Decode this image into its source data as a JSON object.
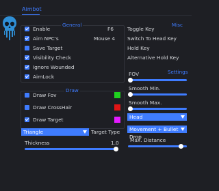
{
  "tabs": {
    "active": "Aimbot"
  },
  "general": {
    "title": "General",
    "items": [
      {
        "label": "Enable",
        "checked": true,
        "key": "F6"
      },
      {
        "label": "Aim NPC's",
        "checked": true,
        "key": "Mouse 4"
      },
      {
        "label": "Save Target",
        "checked": false
      },
      {
        "label": "Visibility Check",
        "checked": true
      },
      {
        "label": "Ignore Wounded",
        "checked": true
      },
      {
        "label": "AimLock",
        "checked": true
      }
    ]
  },
  "misc": {
    "title": "Misc",
    "items": [
      "Toggle Key",
      "Switch To Head Key",
      "Hold Key",
      "Alternative Hold Key"
    ]
  },
  "draw": {
    "title": "Draw",
    "items": [
      {
        "label": "Draw Fov",
        "checked": false,
        "color": "#1fd11f"
      },
      {
        "label": "Draw CrossHair",
        "checked": false,
        "color": "#e01515"
      },
      {
        "label": "Draw Target",
        "checked": true,
        "color": "#e41bff"
      }
    ],
    "target_type": {
      "selected": "Triangle",
      "label": "Target Type"
    },
    "thickness": {
      "label": "Thickness",
      "value": "1.0",
      "fraction": 1.0
    }
  },
  "settings": {
    "title": "Settings",
    "fov": {
      "label": "FOV",
      "fraction": 0.0
    },
    "smooth_min": {
      "label": "Smooth Min.",
      "fraction": 0.0
    },
    "smooth_max": {
      "label": "Smooth Max.",
      "fraction": 0.0
    },
    "bone": {
      "selected": "Head"
    },
    "prediction": {
      "selected": "Movement + Bullet Drop"
    },
    "max_distance": {
      "label": "Max. Distance",
      "fraction": 0.93
    }
  }
}
